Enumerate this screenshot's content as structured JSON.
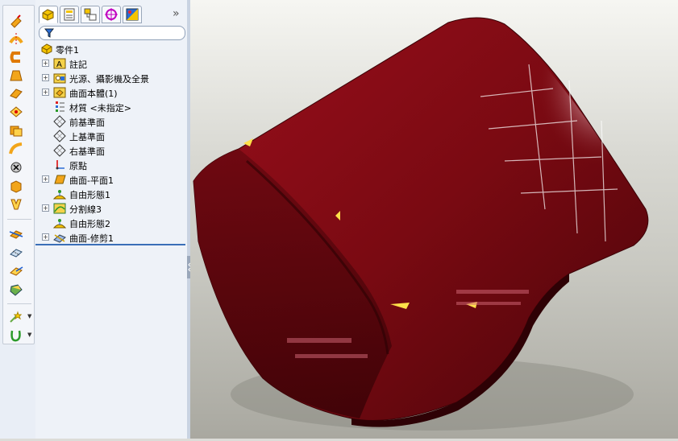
{
  "feature_manager": {
    "tabs": [
      {
        "icon": "feature-manager-icon",
        "active": true
      },
      {
        "icon": "property-manager-icon",
        "active": false
      },
      {
        "icon": "configuration-manager-icon",
        "active": false
      },
      {
        "icon": "dimxpert-icon",
        "active": false
      },
      {
        "icon": "display-manager-icon",
        "active": false
      }
    ],
    "more_label": "»",
    "filter_placeholder": "",
    "tree": [
      {
        "label": "零件1",
        "icon": "part-icon",
        "expandable": false,
        "root": true
      },
      {
        "label": "註記",
        "icon": "annotations-icon",
        "expandable": true
      },
      {
        "label": "光源、攝影機及全景",
        "icon": "lights-cameras-scene-icon",
        "expandable": true
      },
      {
        "label": "曲面本體(1)",
        "icon": "surface-bodies-icon",
        "expandable": true
      },
      {
        "label": "材質 <未指定>",
        "icon": "material-icon",
        "expandable": false
      },
      {
        "label": "前基準面",
        "icon": "plane-icon",
        "expandable": false
      },
      {
        "label": "上基準面",
        "icon": "plane-icon",
        "expandable": false
      },
      {
        "label": "右基準面",
        "icon": "plane-icon",
        "expandable": false
      },
      {
        "label": "原點",
        "icon": "origin-icon",
        "expandable": false
      },
      {
        "label": "曲面-平面1",
        "icon": "planar-surface-icon",
        "expandable": true
      },
      {
        "label": "自由形態1",
        "icon": "freeform-icon",
        "expandable": false
      },
      {
        "label": "分割線3",
        "icon": "split-line-icon",
        "expandable": true
      },
      {
        "label": "自由形態2",
        "icon": "freeform-icon",
        "expandable": false
      },
      {
        "label": "曲面-修剪1",
        "icon": "trim-surface-icon",
        "expandable": true
      }
    ]
  },
  "toolbar_icons": [
    "extruded-surface-icon",
    "revolved-surface-icon",
    "swept-surface-icon",
    "lofted-surface-icon",
    "boundary-surface-icon",
    "filled-surface-icon",
    "freeform-icon",
    "planar-surface-icon",
    "offset-surface-icon",
    "ruled-surface-icon",
    "delete-face-icon",
    "replace-face-icon",
    "trim-surface-icon",
    "untrim-surface-icon",
    "extend-surface-icon",
    "knit-surface-icon",
    "curves-icon",
    "reference-geometry-icon"
  ],
  "colors": {
    "model": "#7a0a12",
    "background_top": "#f6f6f2",
    "background_bottom": "#a9a8a0",
    "selection": "#3a6fb8"
  }
}
